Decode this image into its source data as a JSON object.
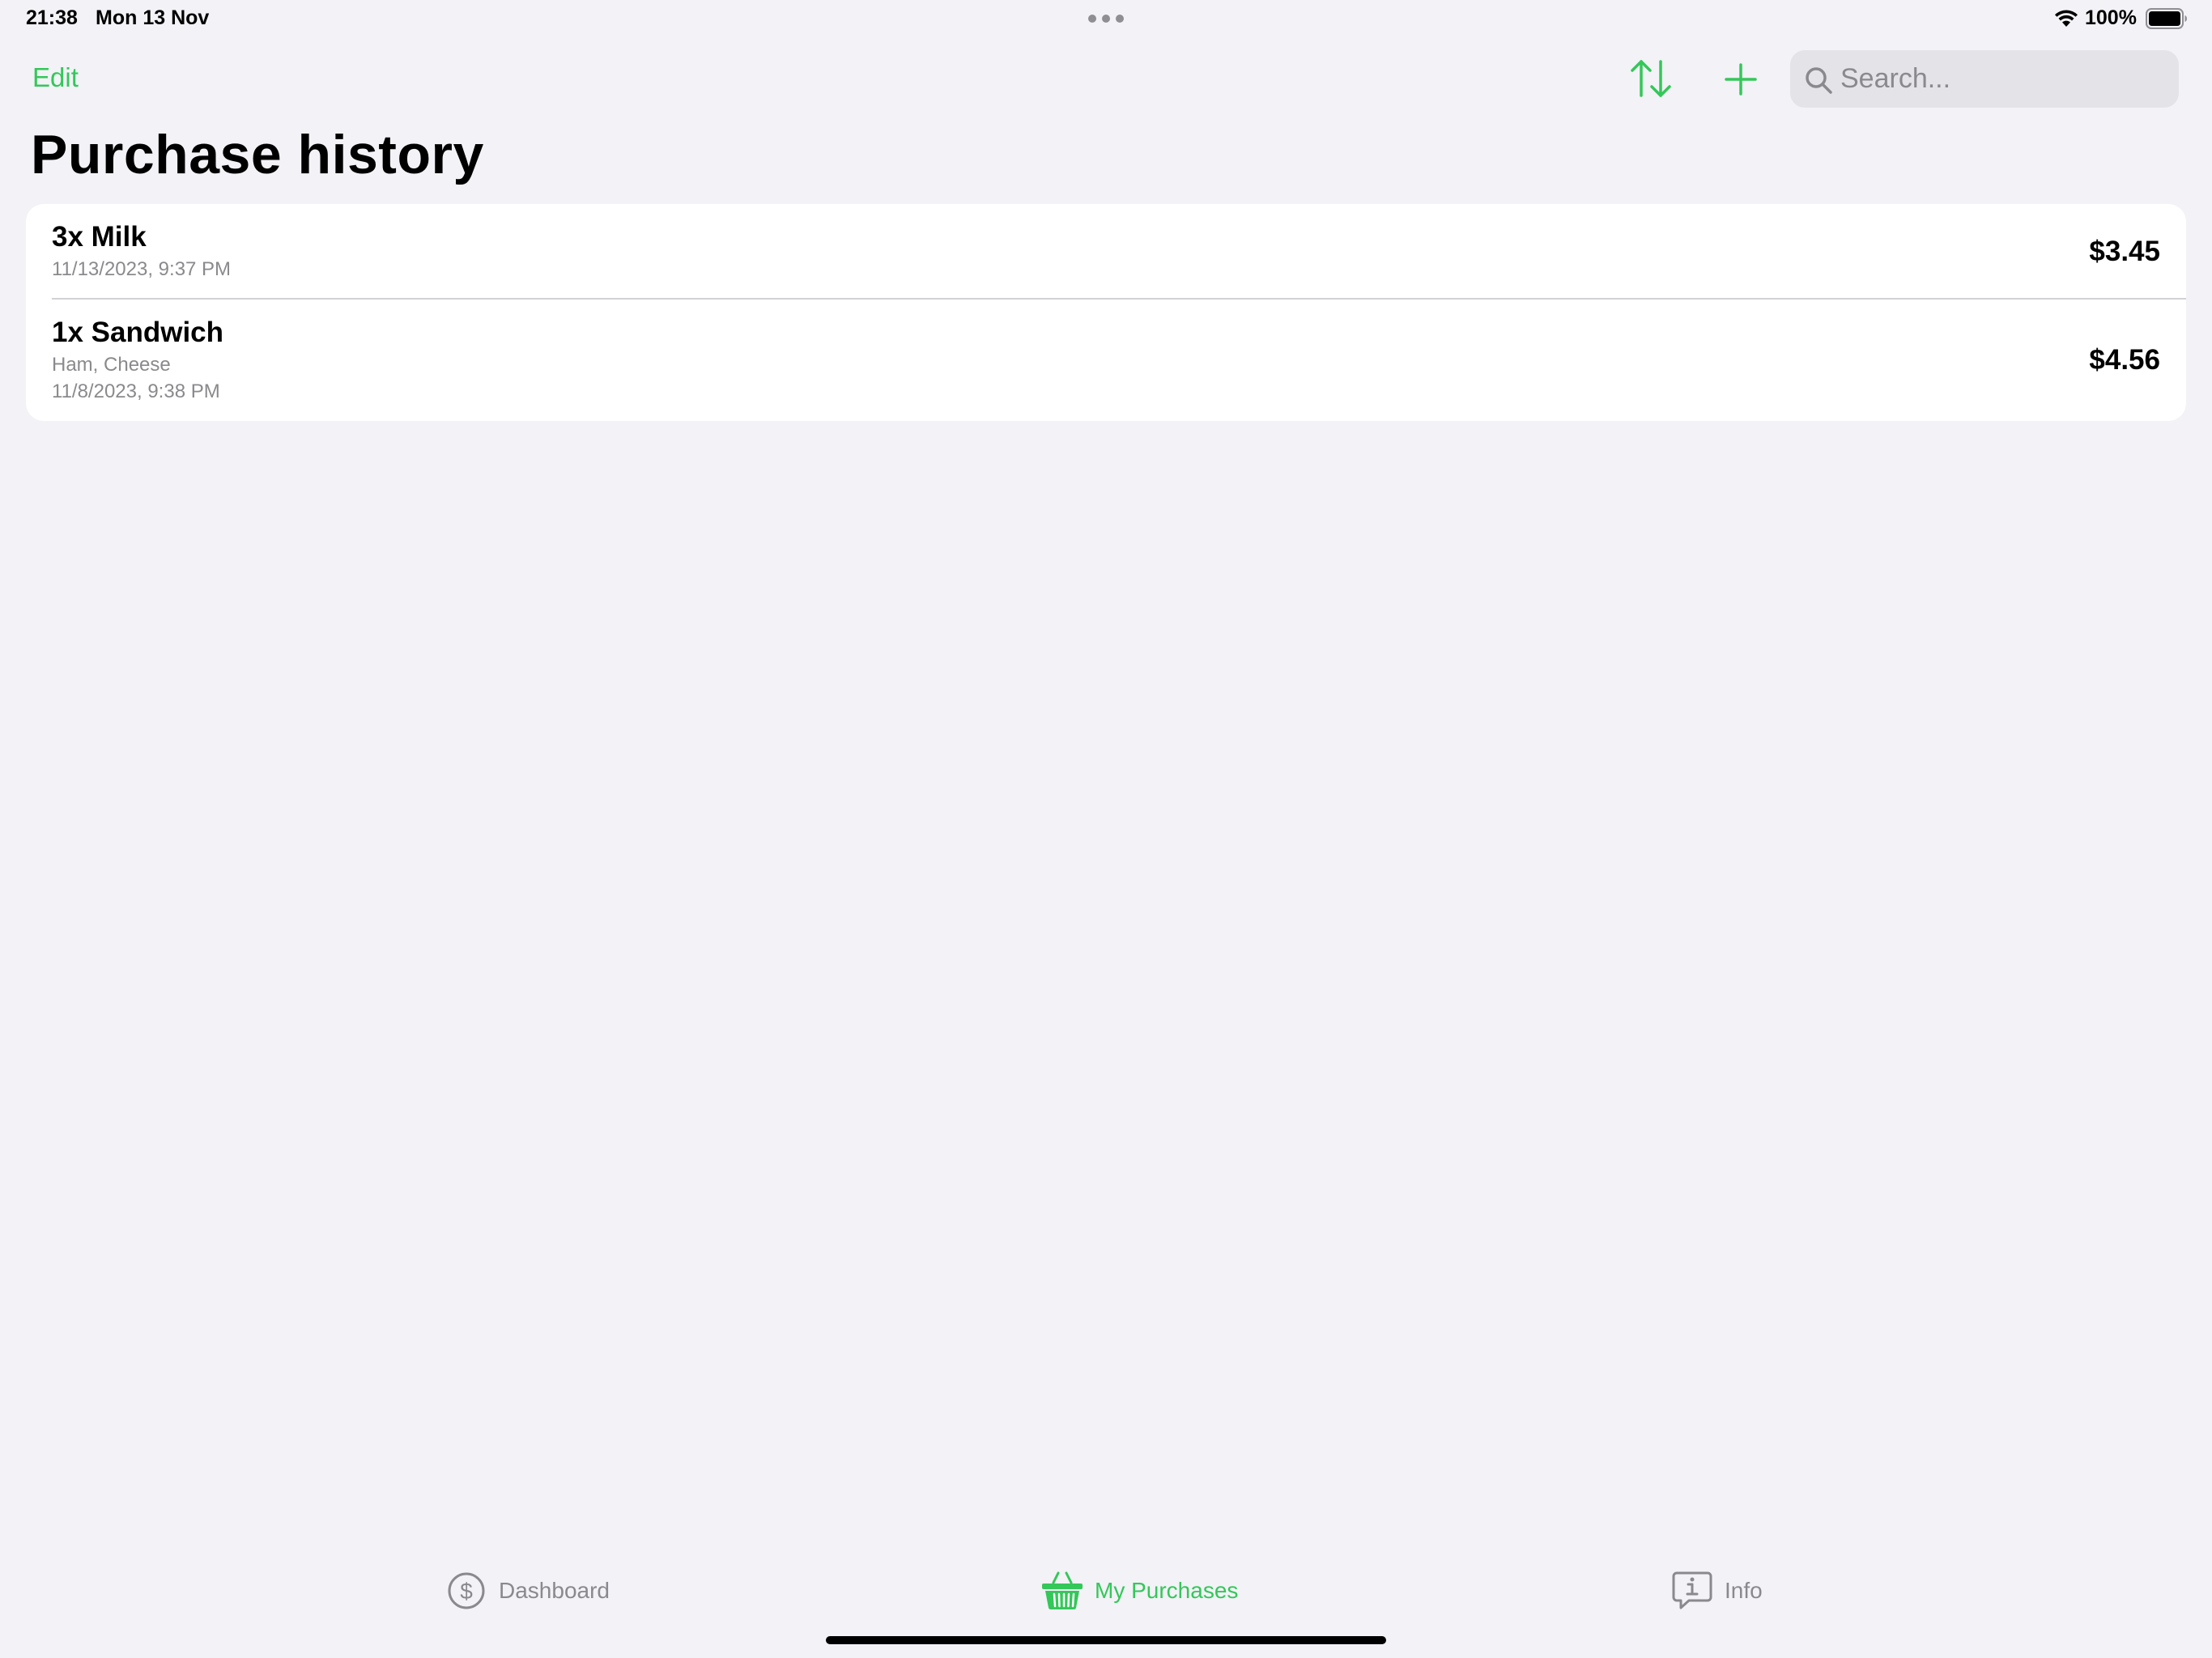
{
  "status_bar": {
    "time": "21:38",
    "date": "Mon 13 Nov",
    "battery_percent": "100%",
    "battery_level": 1.0
  },
  "nav": {
    "edit_label": "Edit",
    "sort_icon": "arrow-up-down-icon",
    "add_icon": "plus-icon",
    "search_placeholder": "Search..."
  },
  "page_title": "Purchase history",
  "purchases": [
    {
      "title": "3x Milk",
      "details": "",
      "date": "11/13/2023, 9:37 PM",
      "price": "$3.45"
    },
    {
      "title": "1x Sandwich",
      "details": "Ham, Cheese",
      "date": "11/8/2023, 9:38 PM",
      "price": "$4.56"
    }
  ],
  "tabs": [
    {
      "label": "Dashboard",
      "icon": "dollar-circle-icon",
      "selected": false
    },
    {
      "label": "My Purchases",
      "icon": "basket-icon",
      "selected": true
    },
    {
      "label": "Info",
      "icon": "info-bubble-icon",
      "selected": false
    }
  ],
  "colors": {
    "accent": "#34c759",
    "background": "#f2f2f7",
    "card": "#ffffff",
    "secondary_text": "#8a8a8e"
  }
}
